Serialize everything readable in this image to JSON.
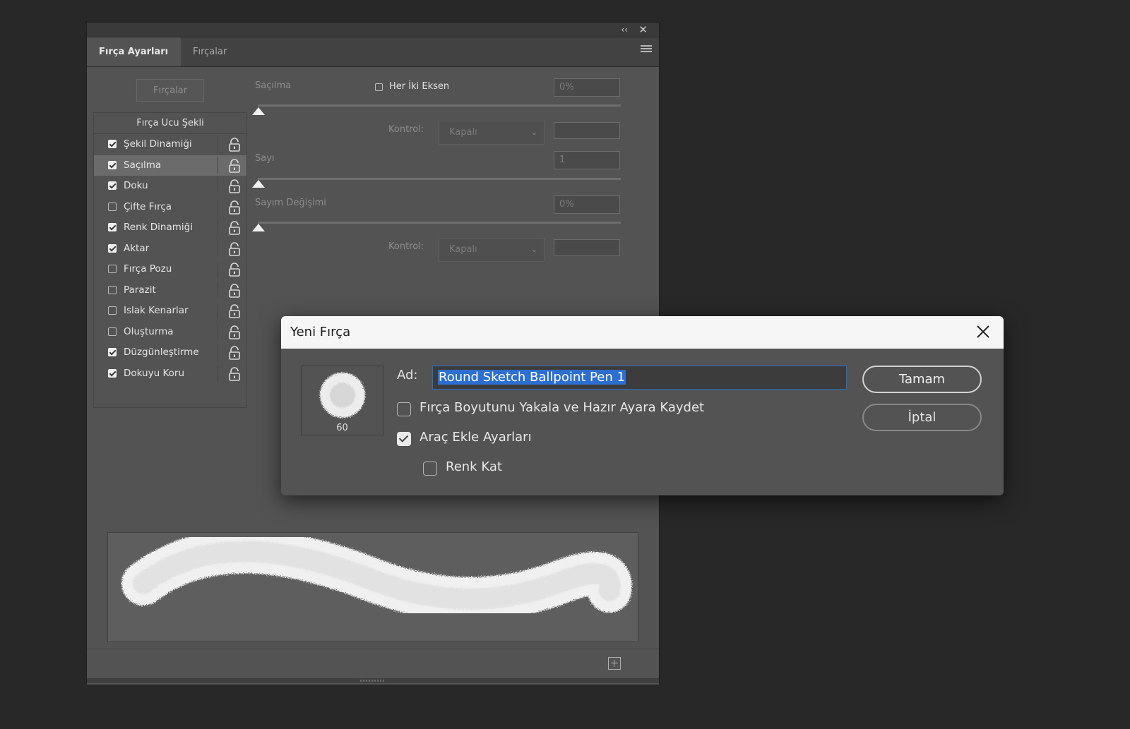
{
  "panel": {
    "tabs": [
      {
        "label": "Fırça Ayarları",
        "active": true
      },
      {
        "label": "Fırçalar",
        "active": false
      }
    ],
    "brushes_button": "Fırçalar",
    "tip_shape": "Fırça Ucu Şekli",
    "items": [
      {
        "label": "Şekil Dinamiği",
        "checked": true,
        "selected": false
      },
      {
        "label": "Saçılma",
        "checked": true,
        "selected": true
      },
      {
        "label": "Doku",
        "checked": true,
        "selected": false
      },
      {
        "label": "Çifte Fırça",
        "checked": false,
        "selected": false
      },
      {
        "label": "Renk Dinamiği",
        "checked": true,
        "selected": false
      },
      {
        "label": "Aktar",
        "checked": true,
        "selected": false
      },
      {
        "label": "Fırça Pozu",
        "checked": false,
        "selected": false
      },
      {
        "label": "Parazit",
        "checked": false,
        "selected": false
      },
      {
        "label": "Islak Kenarlar",
        "checked": false,
        "selected": false
      },
      {
        "label": "Oluşturma",
        "checked": false,
        "selected": false
      },
      {
        "label": "Düzgünleştirme",
        "checked": true,
        "selected": false
      },
      {
        "label": "Dokuyu Koru",
        "checked": true,
        "selected": false
      }
    ],
    "scatter": {
      "label": "Saçılma",
      "both_axes_label": "Her İki Eksen",
      "both_axes_checked": false,
      "value": "0%",
      "slider": 0
    },
    "control1": {
      "label": "Kontrol:",
      "value": "Kapalı"
    },
    "count": {
      "label": "Sayı",
      "value": "1",
      "slider": 0
    },
    "count_jitter": {
      "label": "Sayım Değişimi",
      "value": "0%",
      "slider": 0
    },
    "control2": {
      "label": "Kontrol:",
      "value": "Kapalı"
    }
  },
  "dialog": {
    "title": "Yeni Fırça",
    "brush_size": "60",
    "name_label": "Ad:",
    "name_value": "Round Sketch Ballpoint Pen 1",
    "capture_size_label": "Fırça Boyutunu Yakala ve Hazır Ayara Kaydet",
    "capture_size_checked": false,
    "include_tool_label": "Araç Ekle Ayarları",
    "include_tool_checked": true,
    "include_color_label": "Renk Kat",
    "include_color_checked": false,
    "ok_label": "Tamam",
    "cancel_label": "İptal"
  },
  "icons": {
    "collapse": "double-chevron-left-icon",
    "close": "close-icon",
    "menu": "hamburger-icon",
    "lock": "lock-open-icon",
    "new_brush": "new-brush-icon"
  },
  "colors": {
    "background": "#282828",
    "panel": "#535353",
    "selection": "#2c6fd0"
  }
}
